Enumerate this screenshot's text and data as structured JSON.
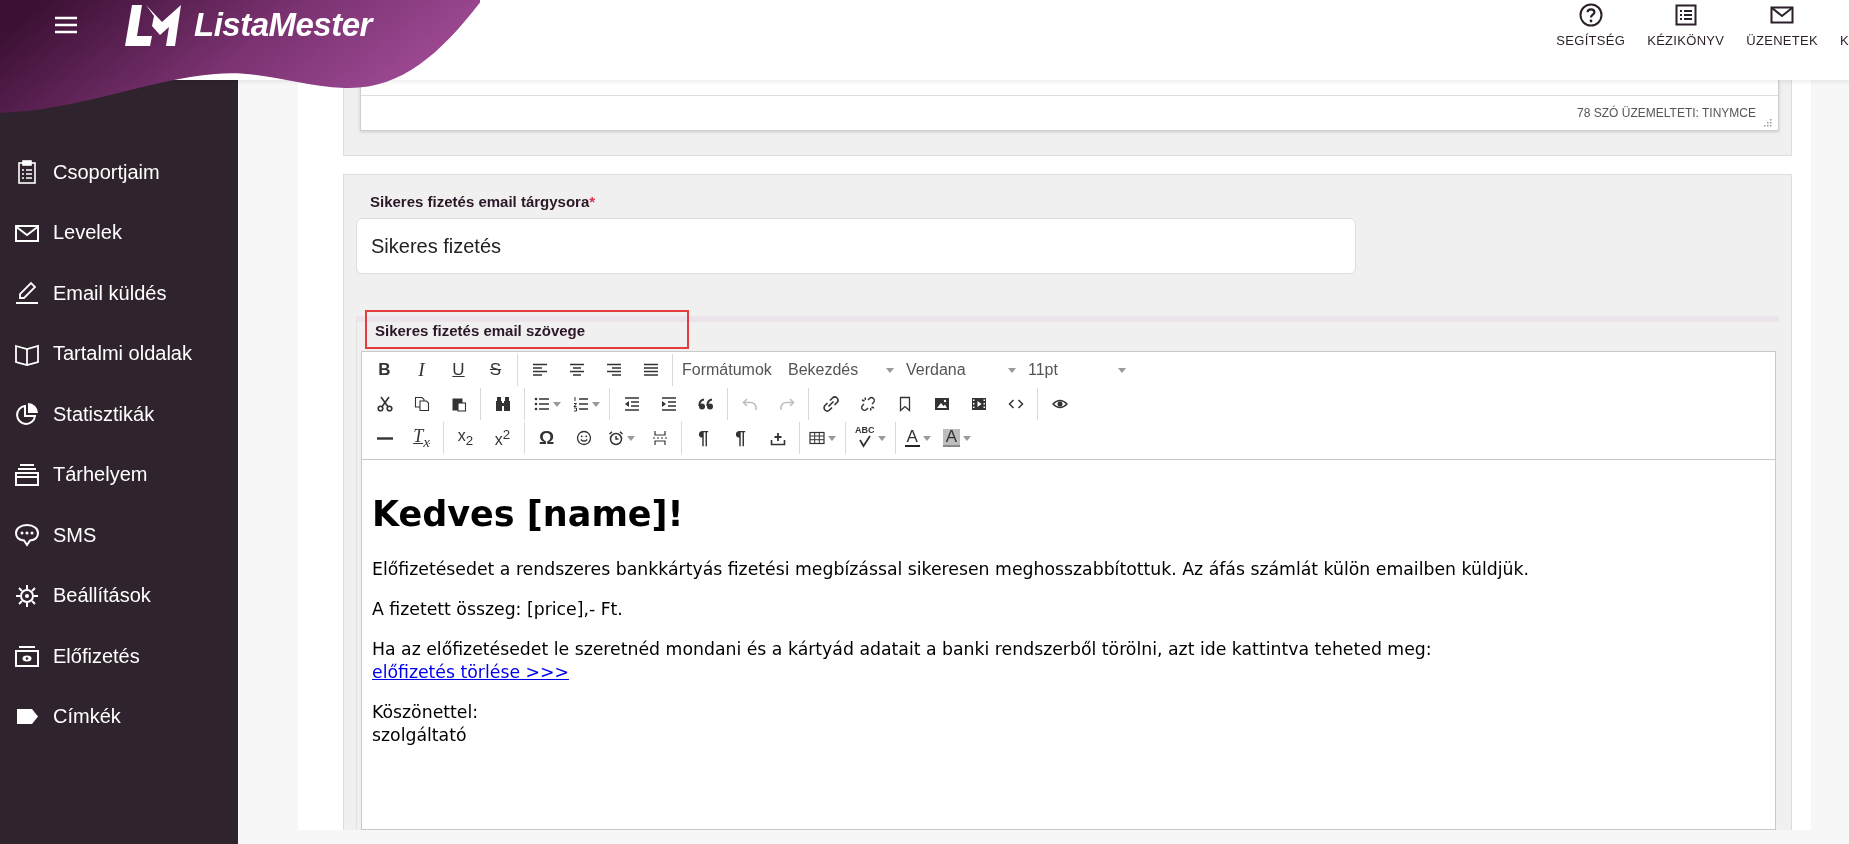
{
  "header": {
    "brand": "ListaMester",
    "nav": [
      {
        "label": "SEGÍTSÉG"
      },
      {
        "label": "KÉZIKÖNYV"
      },
      {
        "label": "ÜZENETEK"
      },
      {
        "label": "K"
      }
    ]
  },
  "sidebar": {
    "items": [
      {
        "label": "Csoportjaim"
      },
      {
        "label": "Levelek"
      },
      {
        "label": "Email küldés"
      },
      {
        "label": "Tartalmi oldalak"
      },
      {
        "label": "Statisztikák"
      },
      {
        "label": "Tárhelyem"
      },
      {
        "label": "SMS"
      },
      {
        "label": "Beállítások"
      },
      {
        "label": "Előfizetés"
      },
      {
        "label": "Címkék"
      }
    ]
  },
  "previous_editor": {
    "status": "78 SZÓ ÜZEMELTETI: TINYMCE"
  },
  "subject": {
    "label": "Sikeres fizetés email tárgysora",
    "required_mark": "*",
    "value": "Sikeres fizetés"
  },
  "body_editor": {
    "label": "Sikeres fizetés email szövege",
    "highlighted": true,
    "toolbar": [
      [
        [
          {
            "kind": "bold",
            "label": "B",
            "disabled": false
          },
          {
            "kind": "italic",
            "label": "I",
            "disabled": false
          },
          {
            "kind": "underline",
            "label": "U",
            "disabled": false
          },
          {
            "kind": "strike",
            "label": "S",
            "disabled": false
          }
        ],
        [
          {
            "kind": "button",
            "disabled": false
          },
          {
            "kind": "button",
            "disabled": false
          },
          {
            "kind": "button",
            "disabled": false
          },
          {
            "kind": "button",
            "disabled": false
          }
        ],
        [
          {
            "kind": "select",
            "label": "Formátumok"
          },
          {
            "kind": "select",
            "label": "Bekezdés"
          },
          {
            "kind": "select",
            "label": "Verdana"
          },
          {
            "kind": "select",
            "label": "11pt"
          }
        ]
      ],
      [
        [
          {
            "kind": "button",
            "disabled": false
          },
          {
            "kind": "button",
            "disabled": false
          },
          {
            "kind": "button",
            "disabled": false
          }
        ],
        [
          {
            "kind": "button",
            "disabled": false
          }
        ],
        [
          {
            "kind": "split",
            "disabled": false
          },
          {
            "kind": "split",
            "disabled": false
          }
        ],
        [
          {
            "kind": "button",
            "disabled": false
          },
          {
            "kind": "button",
            "disabled": false
          },
          {
            "kind": "button",
            "disabled": false
          }
        ],
        [
          {
            "kind": "button",
            "disabled": true
          },
          {
            "kind": "button",
            "disabled": true
          }
        ],
        [
          {
            "kind": "button",
            "disabled": false
          },
          {
            "kind": "button",
            "disabled": false
          },
          {
            "kind": "button",
            "disabled": false
          },
          {
            "kind": "button",
            "disabled": false
          },
          {
            "kind": "button",
            "disabled": false
          },
          {
            "kind": "button",
            "disabled": false
          }
        ],
        [
          {
            "kind": "button",
            "disabled": false
          }
        ]
      ],
      [
        [
          {
            "kind": "button",
            "disabled": false
          },
          {
            "kind": "clear",
            "label": "T$_{x}$",
            "disabled": false
          }
        ],
        [
          {
            "kind": "script",
            "label": "x$_{2}$",
            "disabled": false
          },
          {
            "kind": "script",
            "label": "x$^{2}$",
            "disabled": false
          }
        ],
        [
          {
            "kind": "symbol",
            "label": "Ω",
            "disabled": false
          },
          {
            "kind": "button",
            "disabled": false
          },
          {
            "kind": "split",
            "disabled": false
          },
          {
            "kind": "button",
            "disabled": false
          }
        ],
        [
          {
            "kind": "symbol",
            "label": "¶",
            "disabled": false
          },
          {
            "kind": "symbol",
            "label": "¶",
            "disabled": false
          },
          {
            "kind": "button",
            "disabled": false
          }
        ],
        [
          {
            "kind": "split",
            "disabled": false
          }
        ],
        [
          {
            "kind": "spell",
            "label": "ABC",
            "disabled": false
          }
        ],
        [
          {
            "kind": "forecolor",
            "label": "A",
            "disabled": false
          },
          {
            "kind": "backcolor",
            "label": "A",
            "disabled": false
          }
        ]
      ]
    ],
    "content": [
      {
        "kind": "heading",
        "parts": [
          {
            "kind": "text",
            "text": "Kedves [name]!"
          }
        ]
      },
      {
        "kind": "paragraph",
        "parts": [
          {
            "kind": "text",
            "text": "Előfizetésedet a rendszeres bankkártyás fizetési megbízással sikeresen meghosszabbítottuk. Az áfás számlát külön emailben küldjük."
          }
        ]
      },
      {
        "kind": "paragraph",
        "parts": [
          {
            "kind": "text",
            "text": "A fizetett összeg: [price],- Ft."
          }
        ]
      },
      {
        "kind": "paragraph",
        "parts": [
          {
            "kind": "text",
            "text": "Ha az előfizetésedet le szeretnéd mondani és a kártyád adatait a banki rendszerből törölni, azt ide kattintva teheted meg:"
          },
          {
            "kind": "link",
            "text": "előfizetés törlése >>>"
          }
        ]
      },
      {
        "kind": "paragraph",
        "parts": [
          {
            "kind": "text",
            "text": "Köszönettel:"
          },
          {
            "kind": "text",
            "text": "szolgáltató"
          }
        ]
      }
    ]
  }
}
